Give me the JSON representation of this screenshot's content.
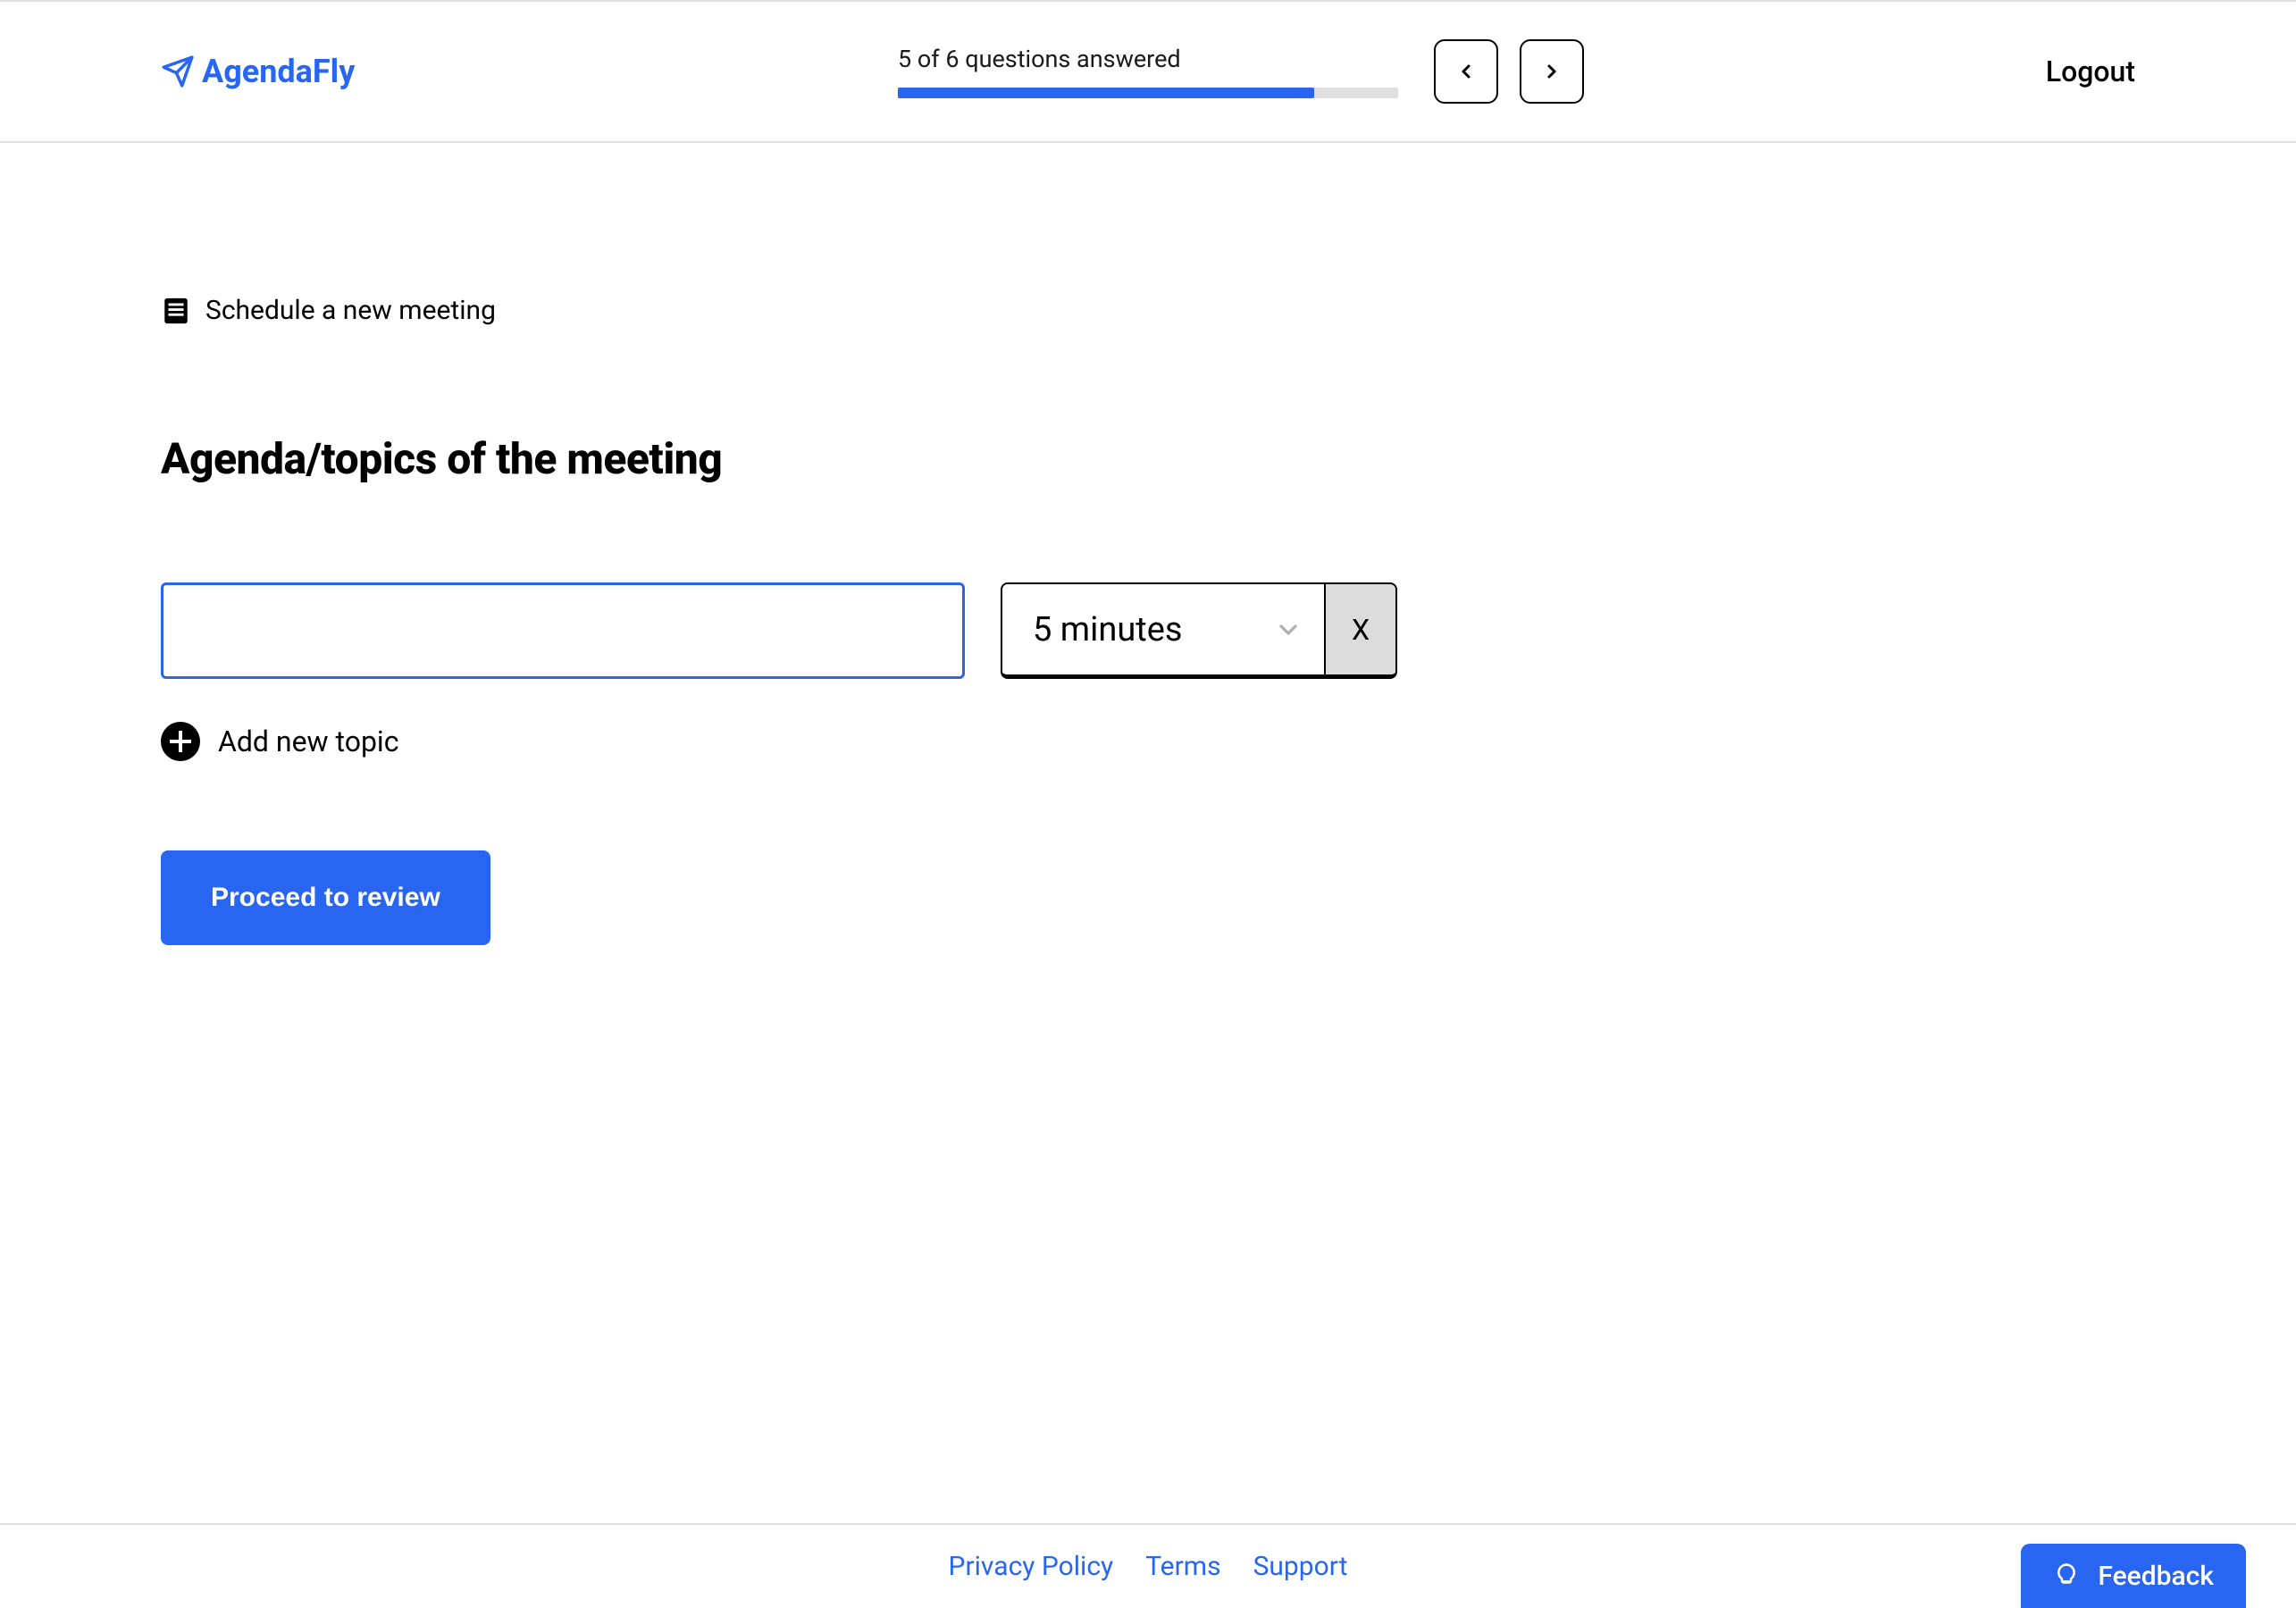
{
  "header": {
    "logo_text": "AgendaFly",
    "progress_text": "5 of 6 questions answered",
    "progress_percent": 83.3,
    "logout_label": "Logout"
  },
  "main": {
    "breadcrumb_label": "Schedule a new meeting",
    "page_title": "Agenda/topics of the meeting",
    "topic_input_value": "",
    "duration_selected": "5 minutes",
    "remove_label": "X",
    "add_topic_label": "Add new topic",
    "proceed_label": "Proceed to review"
  },
  "footer": {
    "links": [
      "Privacy Policy",
      "Terms",
      "Support"
    ],
    "feedback_label": "Feedback"
  },
  "colors": {
    "primary": "#2866f2"
  }
}
